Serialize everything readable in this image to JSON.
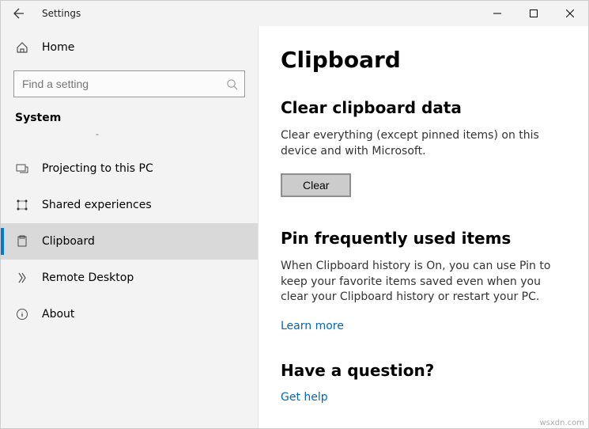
{
  "titlebar": {
    "app_title": "Settings"
  },
  "sidebar": {
    "home_label": "Home",
    "search_placeholder": "Find a setting",
    "section_label": "System",
    "dash": "-",
    "items": [
      {
        "label": "Projecting to this PC"
      },
      {
        "label": "Shared experiences"
      },
      {
        "label": "Clipboard"
      },
      {
        "label": "Remote Desktop"
      },
      {
        "label": "About"
      }
    ]
  },
  "main": {
    "title": "Clipboard",
    "clear": {
      "heading": "Clear clipboard data",
      "desc": "Clear everything (except pinned items) on this device and with Microsoft.",
      "button": "Clear"
    },
    "pin": {
      "heading": "Pin frequently used items",
      "desc": "When Clipboard history is On, you can use Pin to keep your favorite items saved even when you clear your Clipboard history or restart your PC.",
      "link": "Learn more"
    },
    "question": {
      "heading": "Have a question?",
      "link": "Get help"
    }
  },
  "footer": "wsxdn.com"
}
